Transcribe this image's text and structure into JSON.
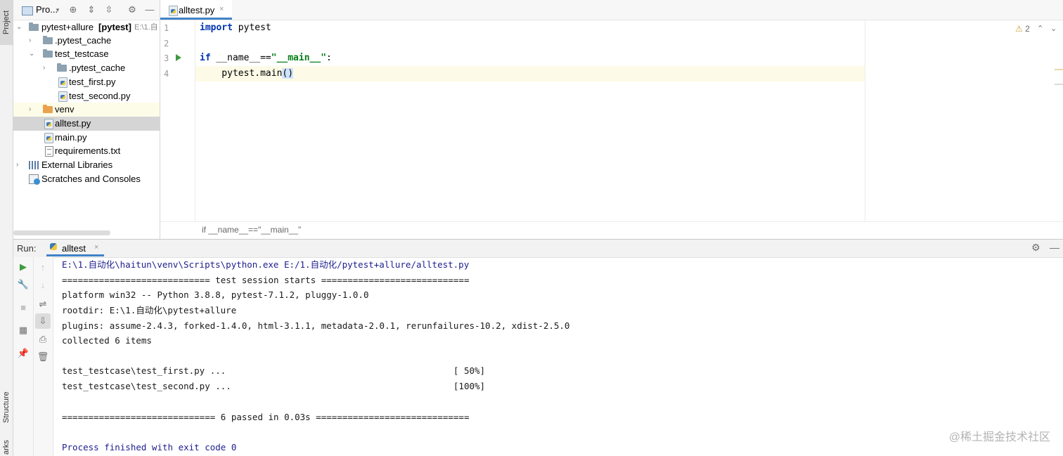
{
  "side_tabs": {
    "project": "Project",
    "structure": "Structure",
    "bookmarks": "arks"
  },
  "project_panel": {
    "title": "Pro...",
    "icons": [
      "project-view-icon",
      "dropdown-icon",
      "locate-icon",
      "expand-all-icon",
      "collapse-all-icon",
      "gear-icon",
      "hide-icon"
    ],
    "tree": [
      {
        "label": "pytest+allure",
        "bold_suffix": "[pytest]",
        "path": "E:\\1.自",
        "depth": 0,
        "expanded": true,
        "type": "folder"
      },
      {
        "label": ".pytest_cache",
        "depth": 1,
        "expanded": false,
        "type": "folder"
      },
      {
        "label": "test_testcase",
        "depth": 1,
        "expanded": true,
        "type": "folder"
      },
      {
        "label": ".pytest_cache",
        "depth": 2,
        "expanded": false,
        "type": "folder"
      },
      {
        "label": "test_first.py",
        "depth": 2,
        "type": "py"
      },
      {
        "label": "test_second.py",
        "depth": 2,
        "type": "py"
      },
      {
        "label": "venv",
        "depth": 1,
        "expanded": false,
        "type": "folder-orange"
      },
      {
        "label": "alltest.py",
        "depth": 1,
        "type": "py",
        "selected": true
      },
      {
        "label": "main.py",
        "depth": 1,
        "type": "py"
      },
      {
        "label": "requirements.txt",
        "depth": 1,
        "type": "txt"
      },
      {
        "label": "External Libraries",
        "depth": 0,
        "expanded": false,
        "type": "lib"
      },
      {
        "label": "Scratches and Consoles",
        "depth": 0,
        "type": "scratch"
      }
    ]
  },
  "editor": {
    "tab_label": "alltest.py",
    "line_numbers": [
      "1",
      "2",
      "3",
      "4"
    ],
    "code": {
      "l1_kw": "import",
      "l1_rest": " pytest",
      "l3_kw": "if",
      "l3_a": " __name__==",
      "l3_str": "\"__main__\"",
      "l3_b": ":",
      "l4_a": "    pytest.main",
      "l4_b": "()"
    },
    "warnings": "2",
    "breadcrumb": "if __name__==\"__main__\""
  },
  "run_panel": {
    "label": "Run:",
    "tab_label": "alltest",
    "output": [
      "E:\\1.自动化\\haitun\\venv\\Scripts\\python.exe E:/1.自动化/pytest+allure/alltest.py",
      "============================ test session starts ============================",
      "platform win32 -- Python 3.8.8, pytest-7.1.2, pluggy-1.0.0",
      "rootdir: E:\\1.自动化\\pytest+allure",
      "plugins: assume-2.4.3, forked-1.4.0, html-3.1.1, metadata-2.0.1, rerunfailures-10.2, xdist-2.5.0",
      "collected 6 items",
      "",
      "test_testcase\\test_first.py ...                                           [ 50%]",
      "test_testcase\\test_second.py ...                                          [100%]",
      "",
      "============================= 6 passed in 0.03s =============================",
      "",
      "Process finished with exit code 0"
    ]
  },
  "watermark": "@稀土掘金技术社区"
}
